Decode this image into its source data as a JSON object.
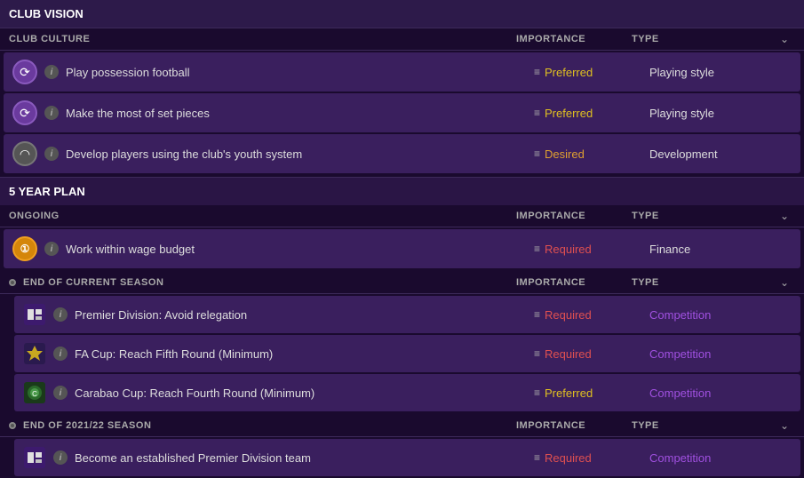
{
  "clubVision": {
    "title": "CLUB VISION"
  },
  "clubCulture": {
    "sectionLabel": "CLUB CULTURE",
    "columns": {
      "importance": "IMPORTANCE",
      "type": "TYPE"
    },
    "rows": [
      {
        "id": "row-1",
        "iconType": "purple-circle",
        "iconSymbol": "↺",
        "label": "Play possession football",
        "importance": "Preferred",
        "importanceClass": "importance-preferred",
        "type": "Playing style",
        "typeClass": ""
      },
      {
        "id": "row-2",
        "iconType": "purple-circle",
        "iconSymbol": "↺",
        "label": "Make the most of set pieces",
        "importance": "Preferred",
        "importanceClass": "importance-preferred",
        "type": "Playing style",
        "typeClass": ""
      },
      {
        "id": "row-3",
        "iconType": "grey-circle",
        "iconSymbol": "◌",
        "label": "Develop players using the club's youth system",
        "importance": "Desired",
        "importanceClass": "importance-desired",
        "type": "Development",
        "typeClass": ""
      }
    ]
  },
  "fiveYearPlan": {
    "title": "5 YEAR PLAN"
  },
  "ongoing": {
    "sectionLabel": "ONGOING",
    "columns": {
      "importance": "IMPORTANCE",
      "type": "TYPE"
    },
    "rows": [
      {
        "id": "ongoing-row-1",
        "iconType": "orange-circle",
        "iconSymbol": "①",
        "label": "Work within wage budget",
        "importance": "Required",
        "importanceClass": "importance-required",
        "type": "Finance",
        "typeClass": ""
      }
    ]
  },
  "endOfCurrentSeason": {
    "sectionLabel": "END OF CURRENT SEASON",
    "columns": {
      "importance": "IMPORTANCE",
      "type": "TYPE"
    },
    "rows": [
      {
        "id": "eos-row-1",
        "badgeType": "premier",
        "label": "Premier Division: Avoid relegation",
        "importance": "Required",
        "importanceClass": "importance-required",
        "type": "Competition",
        "typeClass": "competition-text"
      },
      {
        "id": "eos-row-2",
        "badgeType": "fa-cup",
        "label": "FA Cup: Reach Fifth Round (Minimum)",
        "importance": "Required",
        "importanceClass": "importance-required",
        "type": "Competition",
        "typeClass": "competition-text"
      },
      {
        "id": "eos-row-3",
        "badgeType": "carabao",
        "label": "Carabao Cup: Reach Fourth Round (Minimum)",
        "importance": "Preferred",
        "importanceClass": "importance-preferred",
        "type": "Competition",
        "typeClass": "competition-text"
      }
    ]
  },
  "endOf2021Season": {
    "sectionLabel": "END OF 2021/22 SEASON",
    "columns": {
      "importance": "IMPORTANCE",
      "type": "TYPE"
    },
    "rows": [
      {
        "id": "2021-row-1",
        "badgeType": "premier",
        "label": "Become an established Premier Division team",
        "importance": "Required",
        "importanceClass": "importance-required",
        "type": "Competition",
        "typeClass": "competition-text"
      }
    ]
  }
}
